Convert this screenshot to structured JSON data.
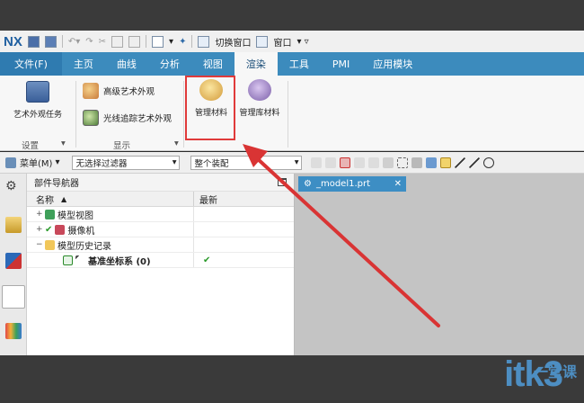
{
  "app": {
    "logo": "NX",
    "switch_window": "切换窗口",
    "window_menu": "窗口"
  },
  "tabs": [
    "文件(F)",
    "主页",
    "曲线",
    "分析",
    "视图",
    "渲染",
    "工具",
    "PMI",
    "应用模块"
  ],
  "active_tab": "渲染",
  "ribbon": {
    "art_task": "艺术外观任务",
    "advanced_art": "高级艺术外观",
    "raytrace_art": "光线追踪艺术外观",
    "manage_material": "管理材料",
    "manage_library": "管理库材料",
    "group_settings": "设置",
    "group_display": "显示"
  },
  "toolbar": {
    "menu": "菜单(M)",
    "filter": "无选择过滤器",
    "assembly": "整个装配"
  },
  "navigator": {
    "title": "部件导航器",
    "col_name": "名称",
    "col_new": "最新",
    "rows": [
      {
        "label": "模型视图",
        "new": ""
      },
      {
        "label": "摄像机",
        "new": ""
      },
      {
        "label": "模型历史记录",
        "new": ""
      },
      {
        "label": "基准坐标系 (0)",
        "new": "✔"
      }
    ]
  },
  "viewport": {
    "tab_label": "_model1.prt"
  },
  "watermark": {
    "text": "itk3",
    "sub": "一堂课"
  },
  "colors": {
    "ribbon_blue": "#3c8bbd",
    "highlight_red": "#e03a3a",
    "arrow_red": "#d93434"
  }
}
